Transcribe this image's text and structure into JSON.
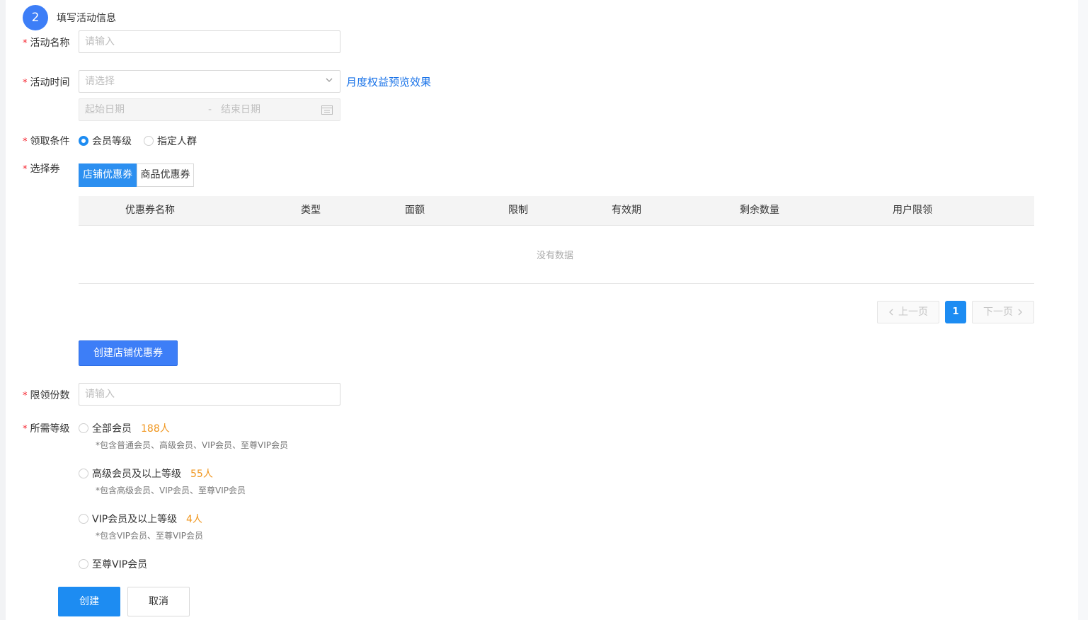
{
  "step": {
    "number": "2",
    "title": "填写活动信息"
  },
  "form": {
    "required_mark": "*",
    "name": {
      "label": "活动名称",
      "placeholder": "请输入"
    },
    "time": {
      "label": "活动时间",
      "placeholder": "请选择",
      "preview_link": "月度权益预览效果",
      "start_placeholder": "起始日期",
      "separator": "-",
      "end_placeholder": "结束日期"
    },
    "condition": {
      "label": "领取条件",
      "options": [
        {
          "label": "会员等级",
          "checked": true
        },
        {
          "label": "指定人群",
          "checked": false
        }
      ]
    },
    "coupon": {
      "label": "选择券",
      "tabs": [
        {
          "label": "店铺优惠券",
          "active": true
        },
        {
          "label": "商品优惠券",
          "active": false
        }
      ],
      "columns": [
        "优惠券名称",
        "类型",
        "面额",
        "限制",
        "有效期",
        "剩余数量",
        "用户限领"
      ],
      "empty_text": "没有数据",
      "pager": {
        "prev": "上一页",
        "current": "1",
        "next": "下一页"
      },
      "create_button": "创建店铺优惠券"
    },
    "limit": {
      "label": "限领份数",
      "placeholder": "请输入"
    },
    "level": {
      "label": "所需等级",
      "options": [
        {
          "label": "全部会员",
          "count": "188人",
          "hint": "*包含普通会员、高级会员、VIP会员、至尊VIP会员"
        },
        {
          "label": "高级会员及以上等级",
          "count": "55人",
          "hint": "*包含高级会员、VIP会员、至尊VIP会员"
        },
        {
          "label": "VIP会员及以上等级",
          "count": "4人",
          "hint": "*包含VIP会员、至尊VIP会员"
        },
        {
          "label": "至尊VIP会员",
          "count": "",
          "hint": ""
        }
      ]
    }
  },
  "actions": {
    "submit": "创建",
    "cancel": "取消"
  },
  "colors": {
    "primary": "#1d8cf2",
    "step": "#3d7ef7",
    "required": "#f5222d",
    "count": "#f0961e",
    "link": "#1a73e8"
  }
}
